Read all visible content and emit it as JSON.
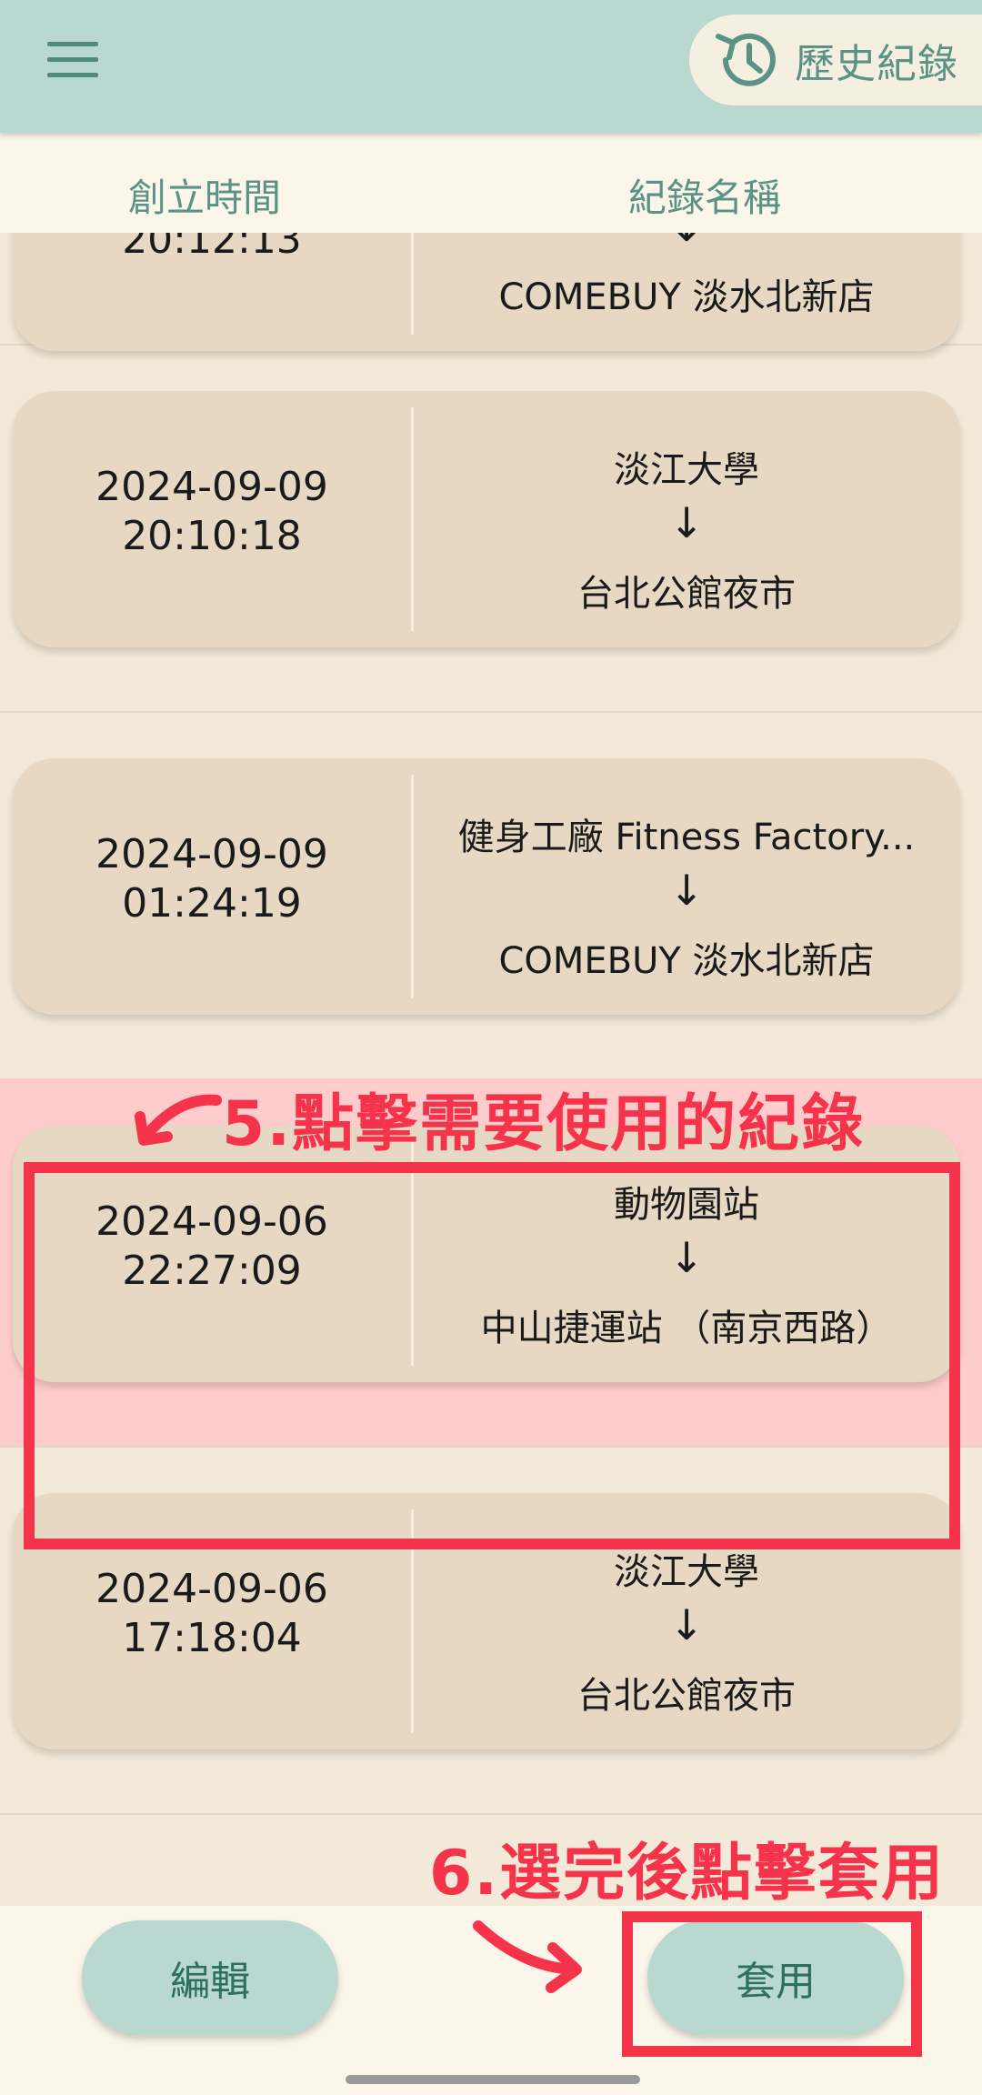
{
  "header": {
    "history_label": "歷史紀錄",
    "history_icon": "history-clock-icon",
    "menu_icon": "hamburger-menu-icon"
  },
  "columns": {
    "time": "創立時間",
    "name": "紀錄名稱"
  },
  "records": [
    {
      "date": "",
      "time": "20:12:13",
      "from": "",
      "arrow": "↓",
      "to": "COMEBUY 淡水北新店"
    },
    {
      "date": "2024-09-09",
      "time": "20:10:18",
      "from": "淡江大學",
      "arrow": "↓",
      "to": "台北公館夜市"
    },
    {
      "date": "2024-09-09",
      "time": "01:24:19",
      "from": "健身工廠 Fitness Factory...",
      "arrow": "↓",
      "to": "COMEBUY 淡水北新店"
    },
    {
      "date": "2024-09-06",
      "time": "22:27:09",
      "from": "動物園站",
      "arrow": "↓",
      "to": "中山捷運站 （南京西路）"
    },
    {
      "date": "2024-09-06",
      "time": "17:18:04",
      "from": "淡江大學",
      "arrow": "↓",
      "to": "台北公館夜市"
    }
  ],
  "annotations": {
    "step5": "5.點擊需要使用的紀錄",
    "step6": "6.選完後點擊套用"
  },
  "buttons": {
    "edit": "編輯",
    "apply": "套用"
  },
  "colors": {
    "accent": "#b9d8cf",
    "accent_text": "#5a9384",
    "card": "#e6d8c2",
    "background": "#f3e9d8",
    "annotation": "#f5334b",
    "selected_row": "#ffcccc"
  }
}
